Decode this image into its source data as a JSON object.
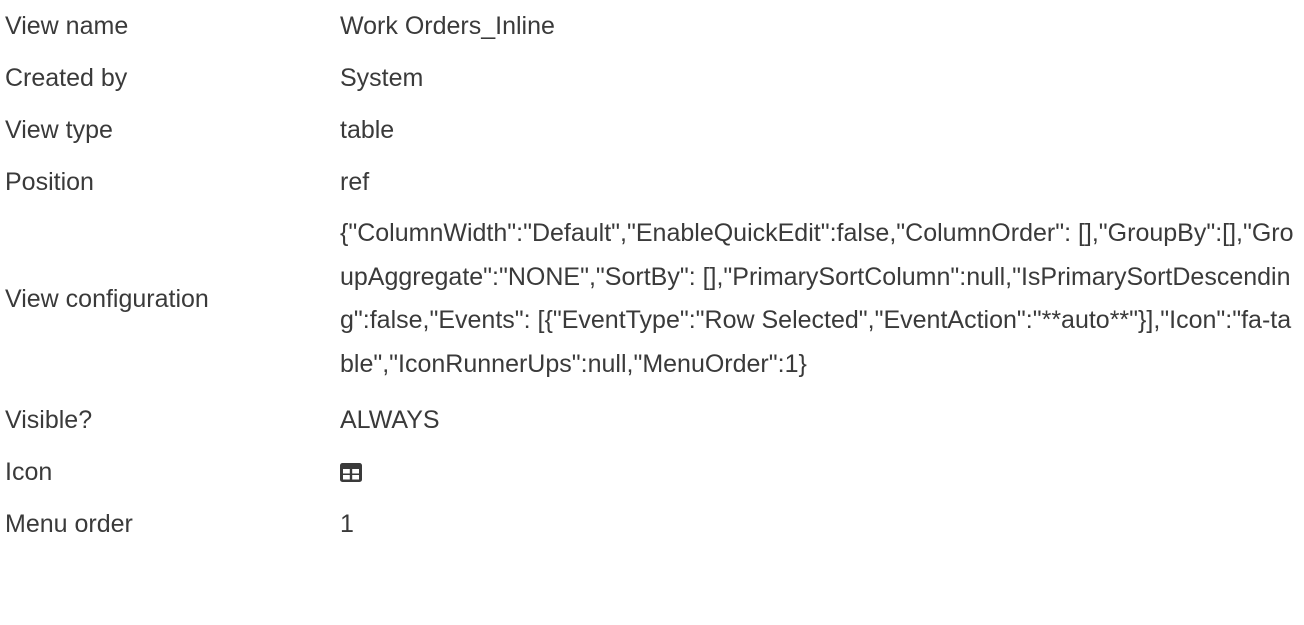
{
  "details": {
    "view_name": {
      "label": "View name",
      "value": "Work Orders_Inline"
    },
    "created_by": {
      "label": "Created by",
      "value": "System"
    },
    "view_type": {
      "label": "View type",
      "value": "table"
    },
    "position": {
      "label": "Position",
      "value": "ref"
    },
    "view_configuration": {
      "label": "View configuration",
      "value": "{\"ColumnWidth\":\"Default\",\"EnableQuickEdit\":false,\"ColumnOrder\": [],\"GroupBy\":[],\"GroupAggregate\":\"NONE\",\"SortBy\": [],\"PrimarySortColumn\":null,\"IsPrimarySortDescending\":false,\"Events\": [{\"EventType\":\"Row Selected\",\"EventAction\":\"**auto**\"}],\"Icon\":\"fa-table\",\"IconRunnerUps\":null,\"MenuOrder\":1}"
    },
    "visible": {
      "label": "Visible?",
      "value": "ALWAYS"
    },
    "icon": {
      "label": "Icon",
      "icon_name": "table-icon"
    },
    "menu_order": {
      "label": "Menu order",
      "value": "1"
    }
  },
  "colors": {
    "text": "#3a3a3a",
    "background": "#ffffff"
  }
}
